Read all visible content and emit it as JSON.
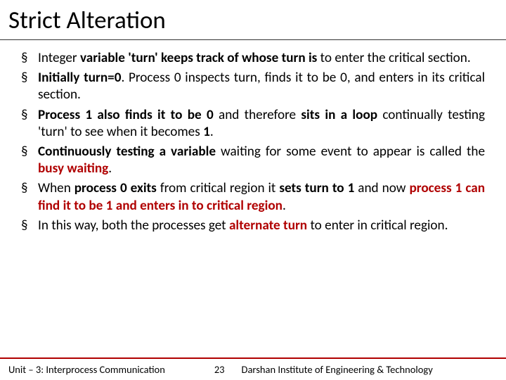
{
  "title": "Strict Alteration",
  "bullets": [
    [
      {
        "t": "Integer "
      },
      {
        "t": "variable 'turn' keeps track of whose turn is",
        "b": 1
      },
      {
        "t": " to enter the critical section."
      }
    ],
    [
      {
        "t": "Initially turn=0",
        "b": 1
      },
      {
        "t": ". Process 0 inspects turn, finds it to be 0, and enters in its critical section."
      }
    ],
    [
      {
        "t": "Process 1 also finds it to be 0",
        "b": 1
      },
      {
        "t": " and therefore "
      },
      {
        "t": "sits in a loop",
        "b": 1
      },
      {
        "t": " continually testing 'turn' to see when it becomes "
      },
      {
        "t": "1",
        "b": 1
      },
      {
        "t": "."
      }
    ],
    [
      {
        "t": "Continuously testing a variable",
        "b": 1
      },
      {
        "t": " waiting for some event to appear is called the "
      },
      {
        "t": "busy waiting",
        "b": 1,
        "r": 1
      },
      {
        "t": "."
      }
    ],
    [
      {
        "t": "When "
      },
      {
        "t": "process 0 exits",
        "b": 1
      },
      {
        "t": " from critical region it "
      },
      {
        "t": "sets turn to 1",
        "b": 1
      },
      {
        "t": " and now "
      },
      {
        "t": "process 1 can find it to be 1 and enters in to critical region",
        "b": 1,
        "r": 1
      },
      {
        "t": "."
      }
    ],
    [
      {
        "t": "In this way, both the processes get "
      },
      {
        "t": "alternate turn",
        "b": 1,
        "r": 1
      },
      {
        "t": " to enter in critical region."
      }
    ]
  ],
  "footer": {
    "unit": "Unit – 3: Interprocess Communication",
    "page": "23",
    "inst": "Darshan Institute of Engineering & Technology"
  }
}
